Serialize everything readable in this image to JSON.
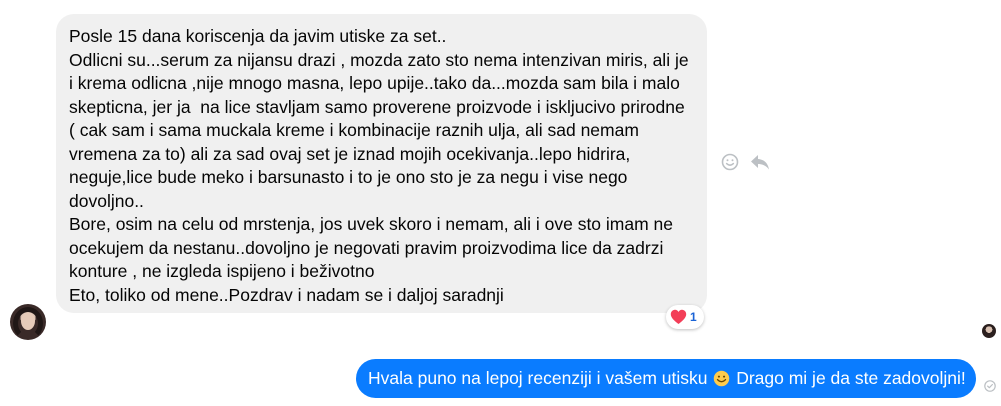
{
  "incoming_message": {
    "lines": [
      "Posle 15 dana koriscenja da javim utiske za set..",
      "Odlicni su...serum za nijansu drazi , mozda zato sto nema intenzivan miris, ali je",
      "i krema odlicna ,nije mnogo masna, lepo upije..tako da...mozda sam bila i malo",
      "skepticna, jer ja  na lice stavljam samo proverene proizvode i iskljucivo prirodne",
      "( cak sam i sama muckala kreme i kombinacije raznih ulja, ali sad nemam",
      "vremena za to) ali za sad ovaj set je iznad mojih ocekivanja..lepo hidrira,",
      "neguje,lice bude meko i barsunasto i to je ono sto je za negu i vise nego",
      "dovoljno..",
      "Bore, osim na celu od mrstenja, jos uvek skoro i nemam, ali i ove sto imam ne",
      "ocekujem da nestanu..dovoljno je negovati pravim proizvodima lice da zadrzi",
      "konture , ne izgleda ispijeno i beživotno",
      "Eto, toliko od mene..Pozdrav i nadam se i daljoj saradnji"
    ],
    "reaction": {
      "icon": "heart-icon",
      "count": "1",
      "color": "#f33e58"
    }
  },
  "outgoing_message": {
    "text_before_emoji": "Hvala puno na lepoj recenziji i vašem utisku ",
    "emoji": "smiling-face-icon",
    "text_after_emoji": " Drago mi je da ste zadovoljni!",
    "bubble_color": "#0a7cff"
  },
  "actions": {
    "react_icon": "smiley-icon",
    "reply_icon": "reply-arrow-icon"
  },
  "colors": {
    "incoming_bubble": "#f0f0f0",
    "outgoing_bubble": "#0a7cff",
    "action_icon": "#bcc0c4"
  }
}
